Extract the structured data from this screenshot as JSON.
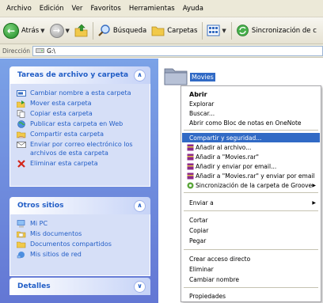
{
  "menubar": [
    "Archivo",
    "Edición",
    "Ver",
    "Favoritos",
    "Herramientas",
    "Ayuda"
  ],
  "toolbar": {
    "back": "Atrás",
    "search": "Búsqueda",
    "folders": "Carpetas",
    "sync": "Sincronización de c"
  },
  "address": {
    "label": "Dirección",
    "value": "G:\\"
  },
  "tasks_panel": {
    "title": "Tareas de archivo y carpeta",
    "items": [
      "Cambiar nombre a esta carpeta",
      "Mover esta carpeta",
      "Copiar esta carpeta",
      "Publicar esta carpeta en Web",
      "Compartir esta carpeta",
      "Enviar por correo electrónico los archivos de esta carpeta",
      "Eliminar esta carpeta"
    ]
  },
  "other_places": {
    "title": "Otros sitios",
    "items": [
      "Mi PC",
      "Mis documentos",
      "Documentos compartidos",
      "Mis sitios de red"
    ]
  },
  "details": {
    "title": "Detalles"
  },
  "folder": {
    "name": "Movies"
  },
  "context_menu": {
    "open": "Abrir",
    "explore": "Explorar",
    "find": "Buscar...",
    "onenote": "Abrir como Bloc de notas en OneNote",
    "share": "Compartir y seguridad...",
    "add_archive": "Añadir al archivo...",
    "add_rar": "Añadir a \"Movies.rar\"",
    "add_email": "Añadir y enviar por email...",
    "add_rar_email": "Añadir a \"Movies.rar\" y enviar por email",
    "groove": "Sincronización de la carpeta de Groove",
    "send_to": "Enviar a",
    "cut": "Cortar",
    "copy": "Copiar",
    "paste": "Pegar",
    "shortcut": "Crear acceso directo",
    "delete": "Eliminar",
    "rename": "Cambiar nombre",
    "properties": "Propiedades"
  },
  "colors": {
    "task_link": "#215dc6",
    "pane_gradient_top": "#7ba2e7",
    "highlight": "#316ac5"
  }
}
